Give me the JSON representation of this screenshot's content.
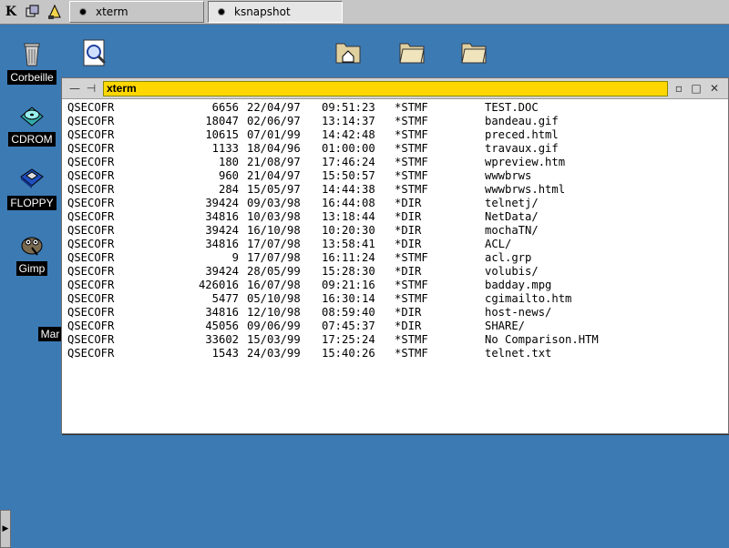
{
  "taskbar": {
    "k_menu_glyph": "K",
    "tasks": [
      {
        "label": "xterm",
        "active": false
      },
      {
        "label": "ksnapshot",
        "active": true
      }
    ]
  },
  "desktop": {
    "icons": [
      {
        "name": "trash",
        "label": "Corbeille"
      },
      {
        "name": "cdrom",
        "label": "CDROM"
      },
      {
        "name": "floppy",
        "label": "FLOPPY"
      },
      {
        "name": "gimp",
        "label": "Gimp"
      },
      {
        "name": "man",
        "label": "Mar"
      }
    ]
  },
  "window": {
    "title": "xterm",
    "minimize_glyph": "—",
    "pin_glyph": "⊣",
    "maximize_glyph": "□",
    "close_glyph": "✕"
  },
  "listing": [
    {
      "user": "QSECOFR",
      "size": "6656",
      "date": "22/04/97",
      "time": "09:51:23",
      "type": "*STMF",
      "name": "TEST.DOC"
    },
    {
      "user": "QSECOFR",
      "size": "18047",
      "date": "02/06/97",
      "time": "13:14:37",
      "type": "*STMF",
      "name": "bandeau.gif"
    },
    {
      "user": "QSECOFR",
      "size": "10615",
      "date": "07/01/99",
      "time": "14:42:48",
      "type": "*STMF",
      "name": "preced.html"
    },
    {
      "user": "QSECOFR",
      "size": "1133",
      "date": "18/04/96",
      "time": "01:00:00",
      "type": "*STMF",
      "name": "travaux.gif"
    },
    {
      "user": "QSECOFR",
      "size": "180",
      "date": "21/08/97",
      "time": "17:46:24",
      "type": "*STMF",
      "name": "wpreview.htm"
    },
    {
      "user": "QSECOFR",
      "size": "960",
      "date": "21/04/97",
      "time": "15:50:57",
      "type": "*STMF",
      "name": "wwwbrws"
    },
    {
      "user": "QSECOFR",
      "size": "284",
      "date": "15/05/97",
      "time": "14:44:38",
      "type": "*STMF",
      "name": "wwwbrws.html"
    },
    {
      "user": "QSECOFR",
      "size": "39424",
      "date": "09/03/98",
      "time": "16:44:08",
      "type": "*DIR",
      "name": "telnetj/"
    },
    {
      "user": "QSECOFR",
      "size": "34816",
      "date": "10/03/98",
      "time": "13:18:44",
      "type": "*DIR",
      "name": "NetData/"
    },
    {
      "user": "QSECOFR",
      "size": "39424",
      "date": "16/10/98",
      "time": "10:20:30",
      "type": "*DIR",
      "name": "mochaTN/"
    },
    {
      "user": "QSECOFR",
      "size": "34816",
      "date": "17/07/98",
      "time": "13:58:41",
      "type": "*DIR",
      "name": "ACL/"
    },
    {
      "user": "QSECOFR",
      "size": "9",
      "date": "17/07/98",
      "time": "16:11:24",
      "type": "*STMF",
      "name": "acl.grp"
    },
    {
      "user": "QSECOFR",
      "size": "39424",
      "date": "28/05/99",
      "time": "15:28:30",
      "type": "*DIR",
      "name": "volubis/"
    },
    {
      "user": "QSECOFR",
      "size": "426016",
      "date": "16/07/98",
      "time": "09:21:16",
      "type": "*STMF",
      "name": "badday.mpg"
    },
    {
      "user": "QSECOFR",
      "size": "5477",
      "date": "05/10/98",
      "time": "16:30:14",
      "type": "*STMF",
      "name": "cgimailto.htm"
    },
    {
      "user": "QSECOFR",
      "size": "34816",
      "date": "12/10/98",
      "time": "08:59:40",
      "type": "*DIR",
      "name": "host-news/"
    },
    {
      "user": "QSECOFR",
      "size": "45056",
      "date": "09/06/99",
      "time": "07:45:37",
      "type": "*DIR",
      "name": "SHARE/"
    },
    {
      "user": "QSECOFR",
      "size": "33602",
      "date": "15/03/99",
      "time": "17:25:24",
      "type": "*STMF",
      "name": "No Comparison.HTM"
    },
    {
      "user": "QSECOFR",
      "size": "1543",
      "date": "24/03/99",
      "time": "15:40:26",
      "type": "*STMF",
      "name": "telnet.txt"
    }
  ],
  "colors": {
    "desktop": "#3c7ab4",
    "title_highlight": "#ffd700"
  }
}
